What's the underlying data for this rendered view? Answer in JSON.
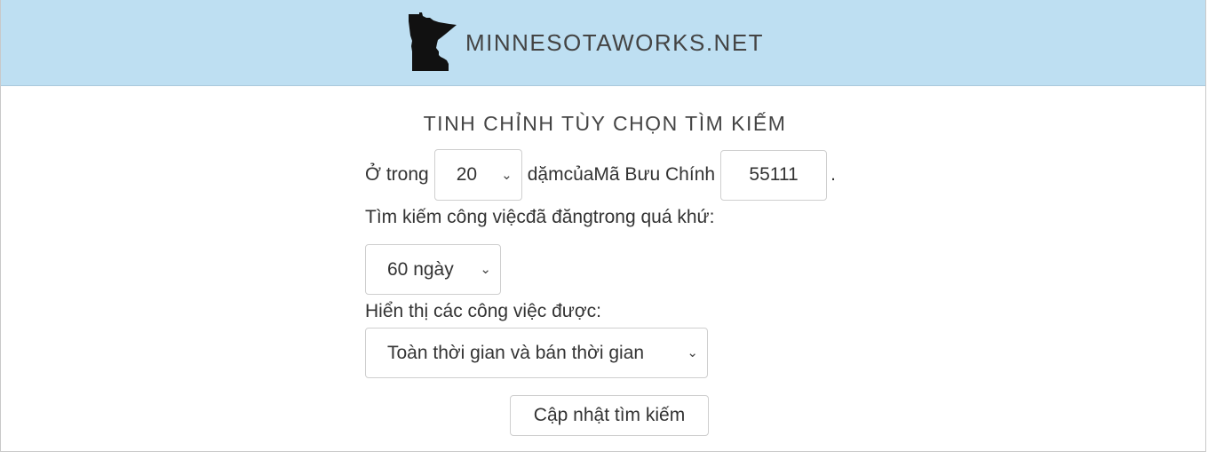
{
  "header": {
    "logo_icon": "minnesota-state-shape",
    "site_name": "MINNESOTAWORKS.NET",
    "background": "#bedff2"
  },
  "refine": {
    "title": "TINH CHỈNH TÙY CHỌN TÌM KIẾM",
    "within_label": "Ở trong",
    "radius_value": "20",
    "miles_of_label": "dặmcủaMã Bưu Chính",
    "zip_value": "55111",
    "period": ".",
    "posted_label": "Tìm kiếm công việcđã đăngtrong quá khứ:",
    "days_value": "60 ngày",
    "show_label": "Hiển thị các công việc được:",
    "job_type_value": "Toàn thời gian và bán thời gian",
    "update_button_label": "Cập nhật tìm kiếm"
  }
}
